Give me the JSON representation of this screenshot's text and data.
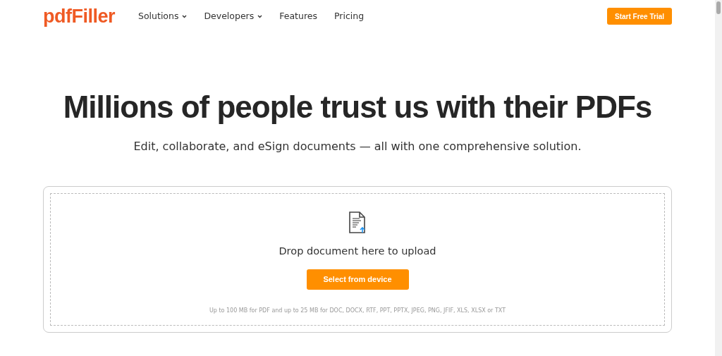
{
  "logo": "pdfFiller",
  "nav": [
    {
      "label": "Solutions",
      "dropdown": true
    },
    {
      "label": "Developers",
      "dropdown": true
    },
    {
      "label": "Features",
      "dropdown": false
    },
    {
      "label": "Pricing",
      "dropdown": false
    }
  ],
  "cta_button": "Start Free Trial",
  "hero": {
    "title": "Millions of people trust us with their PDFs",
    "subtitle": "Edit, collaborate, and eSign documents — all with one comprehensive solution."
  },
  "upload": {
    "prompt": "Drop document here to upload",
    "button": "Select from device",
    "note": "Up to 100 MB for PDF and up to 25 MB for DOC, DOCX, RTF, PPT, PPTX, JPEG, PNG, JFIF, XLS, XLSX or TXT"
  }
}
